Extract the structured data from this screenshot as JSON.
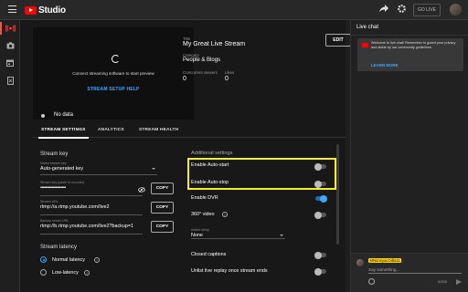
{
  "app": {
    "logo_text": "Studio",
    "go_live": "GO LIVE"
  },
  "rail": {
    "items": [
      "live-icon",
      "camera-icon",
      "calendar-icon",
      "manage-icon"
    ]
  },
  "preview": {
    "message": "Connect streaming software to start preview",
    "setup_link": "STREAM SETUP HELP"
  },
  "stream_info": {
    "title_label": "Title",
    "title": "My Great Live Stream",
    "category_label": "Category",
    "category": "People & Blogs",
    "concurrent_label": "Concurrent viewers",
    "concurrent": "0",
    "likes_label": "Likes",
    "likes": "0",
    "edit": "EDIT"
  },
  "status": {
    "text": "No data"
  },
  "tabs": [
    "STREAM SETTINGS",
    "ANALYTICS",
    "STREAM HEALTH"
  ],
  "stream_key": {
    "section": "Stream key",
    "select_label": "Select stream key",
    "select_value": "Auto-generated key",
    "key_label": "Stream key (paste in encoder)",
    "key_value": "••••••••••••••••••••",
    "url_label": "Stream URL",
    "url_value": "rtmp://a.rtmp.youtube.com/live2",
    "backup_label": "Backup server URL",
    "backup_value": "rtmp://b.rtmp.youtube.com/live2?backup=1",
    "copy": "COPY"
  },
  "latency": {
    "section": "Stream latency",
    "normal": "Normal latency",
    "low": "Low-latency"
  },
  "additional": {
    "section": "Additional settings",
    "auto_start": "Enable Auto-start",
    "auto_stop": "Enable Auto-stop",
    "dvr": "Enable DVR",
    "video360": "360° video",
    "delay_label": "Added delay",
    "delay_value": "None",
    "captions": "Closed captions",
    "unlist": "Unlist live replay once stream ends",
    "toggles": {
      "auto_start": false,
      "auto_stop": false,
      "dvr": true,
      "video360": false,
      "captions": false,
      "unlist": false
    }
  },
  "chat": {
    "title": "Live chat",
    "welcome": "Welcome to live chat! Remember to guard your privacy and abide by our community guidelines.",
    "learn_more": "LEARN MORE",
    "username": "MNoneyacOdla11",
    "placeholder": "Say something...",
    "counter": "0/200"
  },
  "colors": {
    "accent": "#3ea6ff",
    "brand": "#ff0000",
    "highlight": "#f3f020"
  }
}
